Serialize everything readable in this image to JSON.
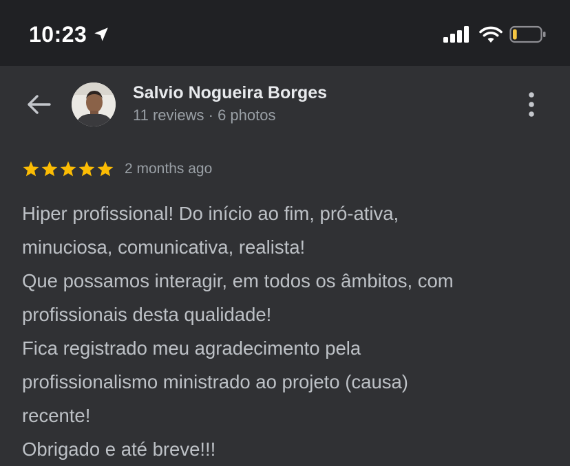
{
  "status_bar": {
    "time": "10:23",
    "location_icon": "location-arrow-icon",
    "signal_icon": "cellular-signal-icon",
    "wifi_icon": "wifi-icon",
    "battery_icon": "battery-low-icon",
    "battery_level": 0.15,
    "battery_color": "#f5c542"
  },
  "header": {
    "back_icon": "arrow-left-icon",
    "avatar": "reviewer-avatar",
    "name": "Salvio Nogueira Borges",
    "meta": "11 reviews · 6 photos",
    "more_icon": "more-vert-icon"
  },
  "review": {
    "rating": 5,
    "rating_max": 5,
    "star_color": "#fbbc04",
    "date": "2 months ago",
    "lines": [
      "Hiper profissional! Do início ao fim, pró-ativa,",
      "minuciosa, comunicativa, realista!",
      "Que possamos interagir, em todos os âmbitos, com",
      "profissionais desta qualidade!",
      "Fica registrado meu agradecimento pela",
      "profissionalismo ministrado ao projeto (causa)",
      "recente!",
      "Obrigado e até breve!!!"
    ]
  },
  "colors": {
    "background": "#303134",
    "status_bar": "#202124",
    "primary_text": "#e8eaed",
    "secondary_text": "#9aa0a6",
    "body_text": "#bdc1c6"
  }
}
